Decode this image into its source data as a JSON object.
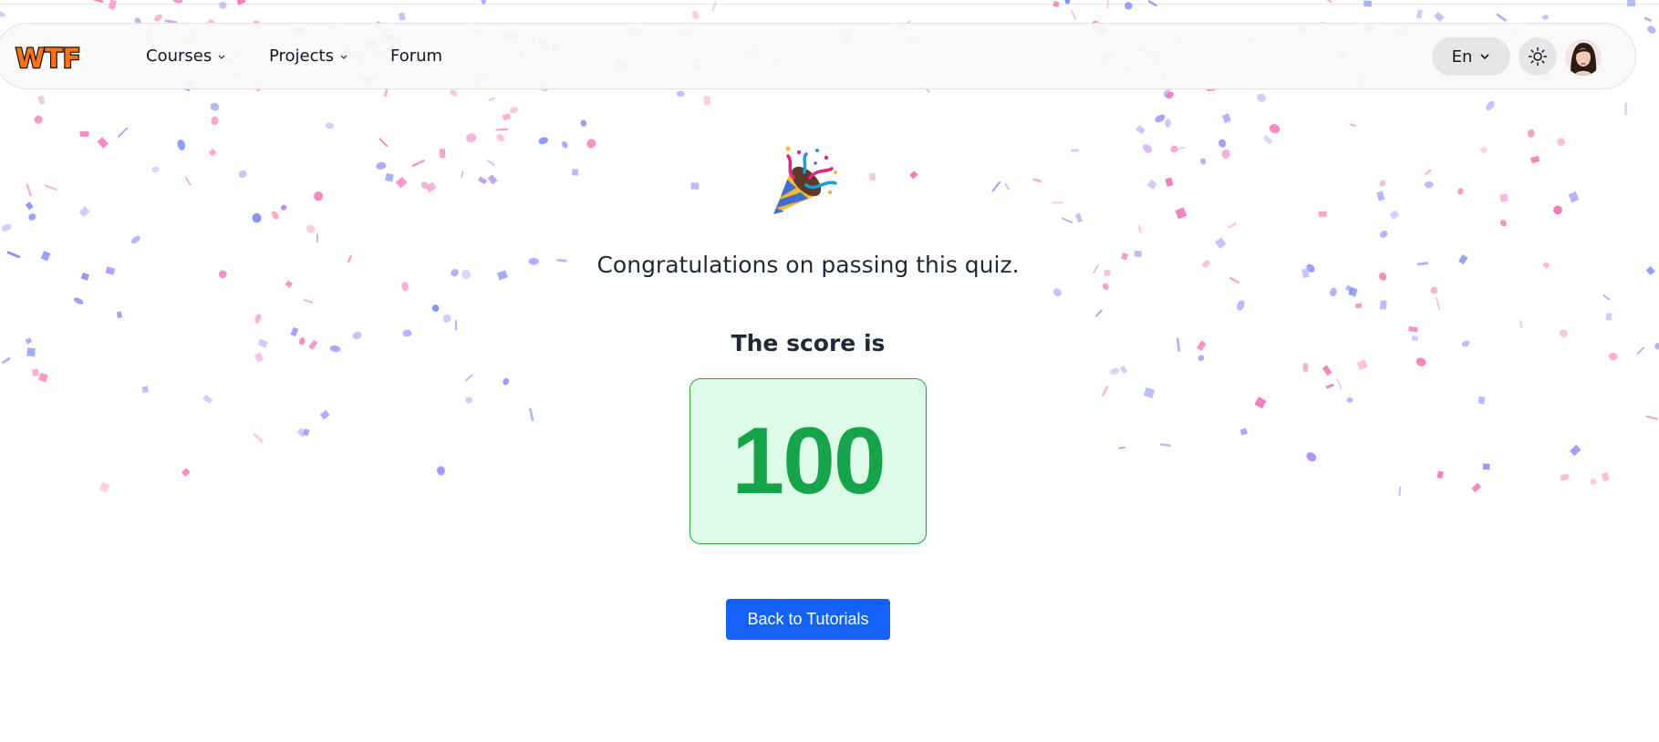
{
  "navbar": {
    "logo_text": "WTF",
    "items": [
      {
        "label": "Courses",
        "has_dropdown": true
      },
      {
        "label": "Projects",
        "has_dropdown": true
      },
      {
        "label": "Forum",
        "has_dropdown": false
      }
    ],
    "language": "En",
    "theme_icon": "sun-icon",
    "avatar_icon": "user-avatar"
  },
  "result": {
    "icon": "party-popper-icon",
    "message": "Congratulations on passing this quiz.",
    "score_label": "The score is",
    "score_value": "100"
  },
  "actions": {
    "back_label": "Back to Tutorials"
  },
  "colors": {
    "accent": "#1462f7",
    "score_green": "#16a34a",
    "score_bg": "#dcfce7",
    "confetti_pink": "#f9a8d4",
    "confetti_purple": "#a78bfa"
  }
}
